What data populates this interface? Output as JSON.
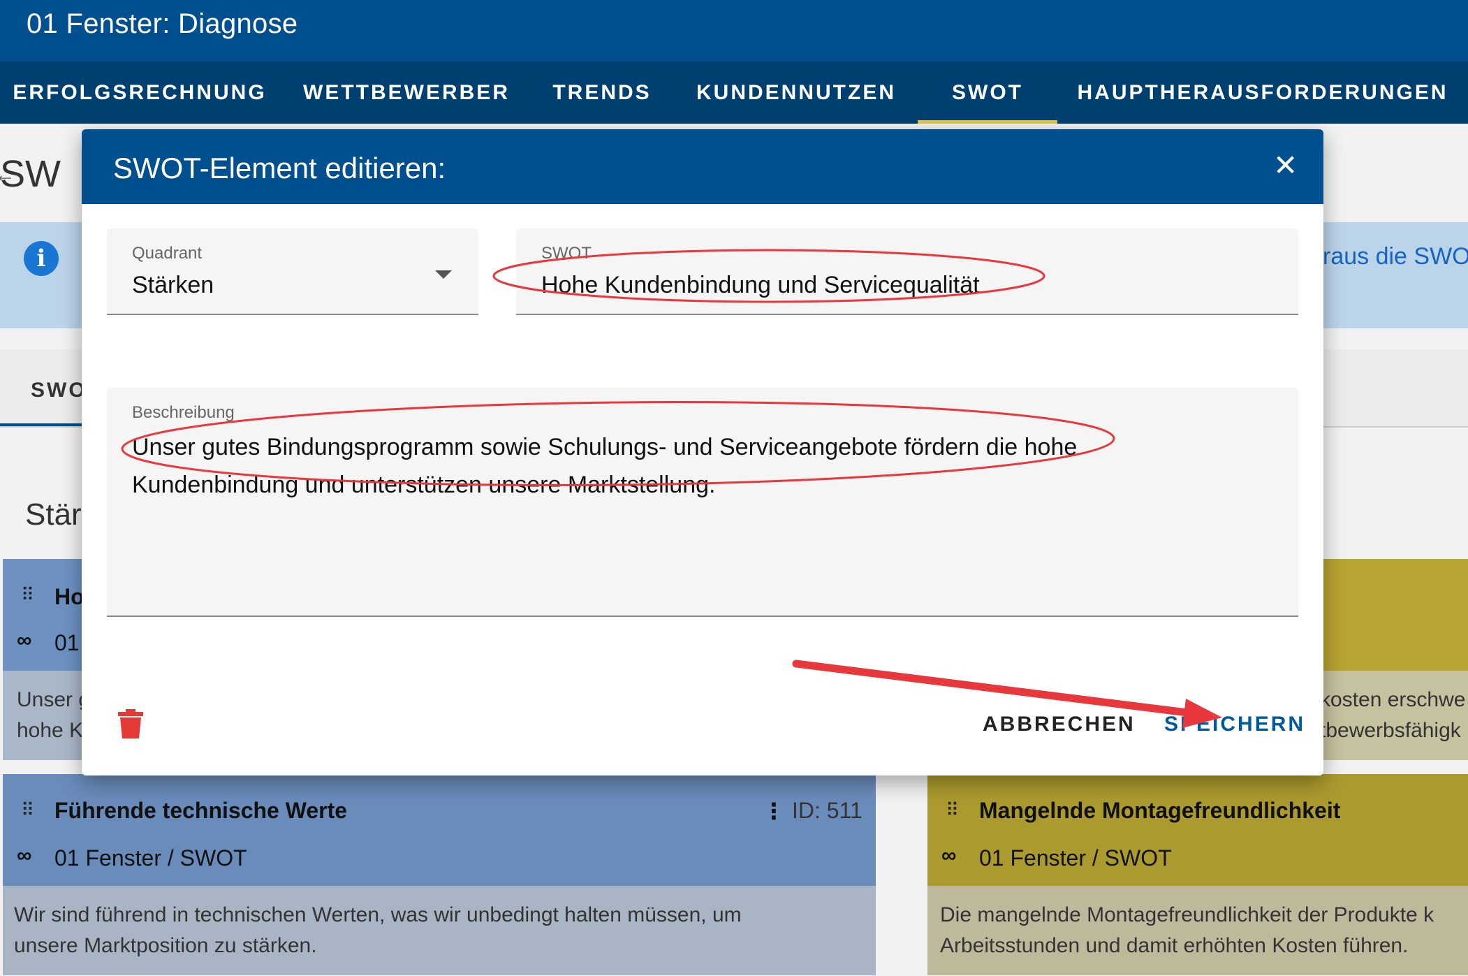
{
  "app": {
    "title": "01 Fenster: Diagnose"
  },
  "tabs": [
    {
      "label": "ERFOLGSRECHNUNG"
    },
    {
      "label": "WETTBEWERBER"
    },
    {
      "label": "TRENDS"
    },
    {
      "label": "KUNDENNUTZEN"
    },
    {
      "label": "SWOT",
      "active": true
    },
    {
      "label": "HAUPTHERAUSFORDERUNGEN"
    }
  ],
  "background": {
    "page_title_partial": "SW",
    "info_text_partial": "raus die SWO",
    "subtab_partial": "SWO",
    "section_partial": "Stär",
    "cards": [
      {
        "title_partial": "Ho",
        "link_partial": "01",
        "body_lines_partial": [
          "Unser g",
          "hohe K"
        ]
      },
      {
        "title": "Führende technische Werte",
        "id_label": "ID: 511",
        "link": "01 Fenster / SWOT",
        "body_lines": [
          "Wir sind führend in technischen Werten, was wir unbedingt halten müssen, um",
          "unsere Marktposition zu stärken."
        ]
      },
      {
        "body_lines_partial": [
          "kosten erschwe",
          "tbewerbsfähigk"
        ]
      },
      {
        "title": "Mangelnde Montagefreundlichkeit",
        "link": "01 Fenster / SWOT",
        "body_lines": [
          "Die mangelnde Montagefreundlichkeit der Produkte k",
          "Arbeitsstunden und damit erhöhten Kosten führen."
        ]
      }
    ]
  },
  "dialog": {
    "title": "SWOT-Element editieren:",
    "close_glyph": "✕",
    "quadrant": {
      "label": "Quadrant",
      "value": "Stärken"
    },
    "swot": {
      "label": "SWOT",
      "value": "Hohe Kundenbindung und Servicequalität"
    },
    "description": {
      "label": "Beschreibung",
      "lines": [
        "Unser gutes Bindungsprogramm sowie Schulungs- und Serviceangebote fördern die hohe",
        "Kundenbindung und unterstützen unsere Marktstellung."
      ]
    },
    "cancel_label": "ABBRECHEN",
    "save_label": "SPEICHERN"
  },
  "colors": {
    "primary": "#004f8e",
    "tab_indicator": "#e2c74b",
    "danger": "#e53935",
    "annotation": "#e8383d"
  },
  "icons": [
    "dropdown-arrow-icon",
    "close-icon",
    "trash-icon",
    "info-icon",
    "drag-handle-icon",
    "link-icon",
    "more-vert-icon"
  ]
}
